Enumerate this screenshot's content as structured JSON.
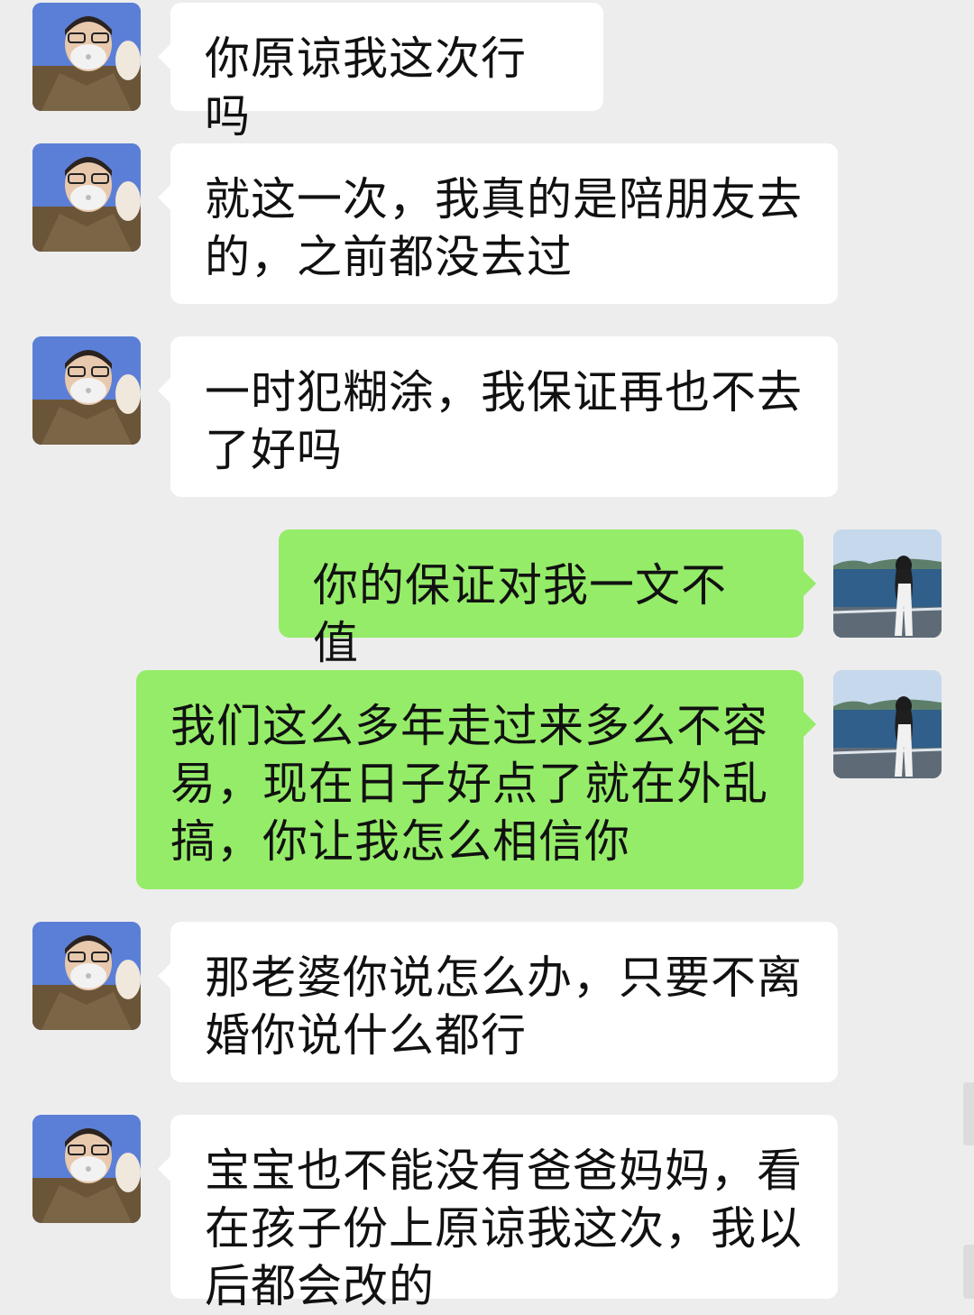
{
  "chat": {
    "messages": [
      {
        "sender": "him",
        "text": "你原谅我这次行吗"
      },
      {
        "sender": "him",
        "text": "就这一次，我真的是陪朋友去的，之前都没去过"
      },
      {
        "sender": "him",
        "text": "一时犯糊涂，我保证再也不去了好吗"
      },
      {
        "sender": "me",
        "text": "你的保证对我一文不值"
      },
      {
        "sender": "me",
        "text": "我们这么多年走过来多么不容易，现在日子好点了就在外乱搞，你让我怎么相信你"
      },
      {
        "sender": "him",
        "text": "那老婆你说怎么办，只要不离婚你说什么都行"
      },
      {
        "sender": "him",
        "text": "宝宝也不能没有爸爸妈妈，看在孩子份上原谅我这次，我以后都会改的"
      }
    ]
  },
  "colors": {
    "background": "#ededed",
    "incoming_bubble": "#ffffff",
    "outgoing_bubble": "#95ec69",
    "text": "#111111"
  },
  "icons": {
    "contact_avatar": "man-with-mask-avatar",
    "my_avatar": "girl-by-sea-avatar"
  }
}
